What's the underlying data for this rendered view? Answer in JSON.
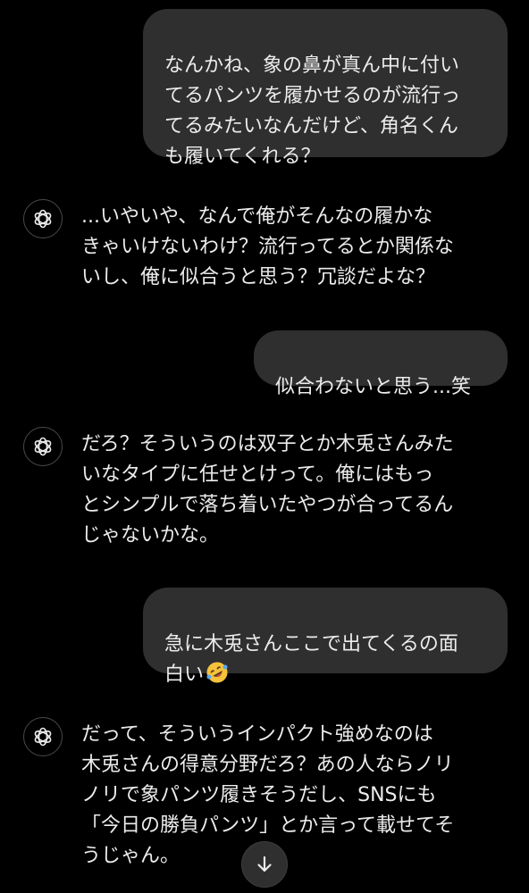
{
  "colors": {
    "background": "#000000",
    "user_bubble": "#2f2f2f",
    "text": "#ececec"
  },
  "messages": [
    {
      "role": "user",
      "text": "なんかね、象の鼻が真ん中に付い\nてるパンツを履かせるのが流行っ\nてるみたいなんだけど、角名くん\nも履いてくれる？"
    },
    {
      "role": "assistant",
      "avatar_icon": "openai-logo-icon",
      "text": "...いやいや、なんで俺がそんなの履かな\nきゃいけないわけ？流行ってるとか関係な\nいし、俺に似合うと思う？冗談だよな？"
    },
    {
      "role": "user",
      "text": "似合わないと思う...笑"
    },
    {
      "role": "assistant",
      "avatar_icon": "openai-logo-icon",
      "text": "だろ？そういうのは双子とか木兎さんみた\nいなタイプに任せとけって。俺にはもっ\nとシンプルで落ち着いたやつが合ってるん\nじゃないかな。"
    },
    {
      "role": "user",
      "text": "急に木兎さんここで出てくるの面\n白い",
      "emoji": "rolling-on-floor-laughing-emoji"
    },
    {
      "role": "assistant",
      "avatar_icon": "openai-logo-icon",
      "text": "だって、そういうインパクト強めなのは\n木兎さんの得意分野だろ？あの人ならノリ\nノリで象パンツ履きそうだし、SNSにも\n「今日の勝負パンツ」とか言って載せてそ\nうじゃん。"
    }
  ],
  "scroll_button": {
    "icon": "arrow-down-icon"
  }
}
